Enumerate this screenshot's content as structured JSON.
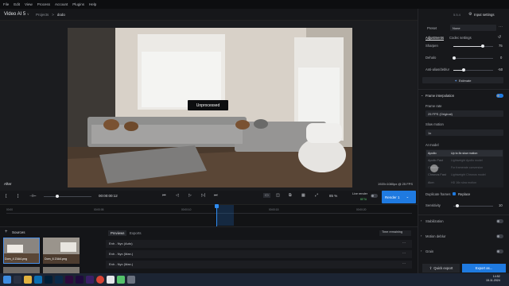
{
  "menu": [
    "File",
    "Edit",
    "View",
    "Process",
    "Account",
    "Plugins",
    "Help"
  ],
  "app": {
    "title": "Video AI 5",
    "title_chevron": "∨",
    "breadcrumb_root": "Projects",
    "breadcrumb_sep": ">",
    "breadcrumb_current": "dodo",
    "version": "5.5.4",
    "input_settings": "Input settings"
  },
  "viewer": {
    "overlay": "Unprocessed",
    "after_label": "After",
    "resolution": "1920×1080px @ 25 FPS"
  },
  "timeline": {
    "timecode": "00:00:00:12",
    "zoom": "85 %",
    "live_render": "Live render",
    "live_render_badge": "BETA",
    "render_button": "Render 1",
    "ticks": [
      "00:00",
      "00:00:05",
      "00:00:10",
      "00:00:15",
      "00:00:20",
      "00:00:25"
    ]
  },
  "sources": {
    "header": "Sources",
    "thumbs": [
      "Dom_4 Z4A4.png",
      "Dom_6 Z4A4.png"
    ]
  },
  "previews": {
    "tabs": [
      "Previews",
      "Exports"
    ],
    "filter": "Time remaining",
    "rows": [
      "Enh - Nyx (Auto)",
      "Enh - Nyx (Man.)",
      "Enh - Nyx (Man.)"
    ]
  },
  "panel": {
    "preset_label": "Preset",
    "preset_value": "None",
    "tab_adjust": "Adjustments",
    "tab_codec": "Codec settings",
    "sharpen_label": "Sharpen",
    "sharpen_value": "75",
    "dehalo_label": "Dehalo",
    "dehalo_value": "0",
    "antialias_label": "Anti-alias/deblur",
    "antialias_value": "-50",
    "estimate_button": "Estimate",
    "fi_section": "Frame interpolation",
    "framerate_label": "Frame rate",
    "framerate_value": "25 FPS (Original)",
    "slowmo_label": "Slow motion",
    "slowmo_value": "1x",
    "aimodel_label": "AI model",
    "models": [
      {
        "name": "Apollo",
        "desc": "Up to 8x slow motion"
      },
      {
        "name": "Apollo Fast",
        "desc": "Lightweight Apollo model"
      },
      {
        "name": "Chronos",
        "desc": "For framerate conversion"
      },
      {
        "name": "Chronos Fast",
        "desc": "Lightweight Chronos model"
      },
      {
        "name": "Aion",
        "desc": "HD 16x slow motion"
      }
    ],
    "duplicate_label": "Duplicate frames",
    "replace_label": "Replace",
    "sensitivity_label": "Sensitivity",
    "sensitivity_value": "10",
    "stabilization": "Stabilization",
    "motion_deblur": "Motion deblur",
    "grain": "Grain",
    "quick_export": "Quick export",
    "export_as": "Export as..."
  },
  "taskbar": {
    "time": "14:52",
    "date": "15.11.2024"
  },
  "colors": {
    "accent": "#1f7ae0",
    "panel_bg": "#17181b"
  }
}
